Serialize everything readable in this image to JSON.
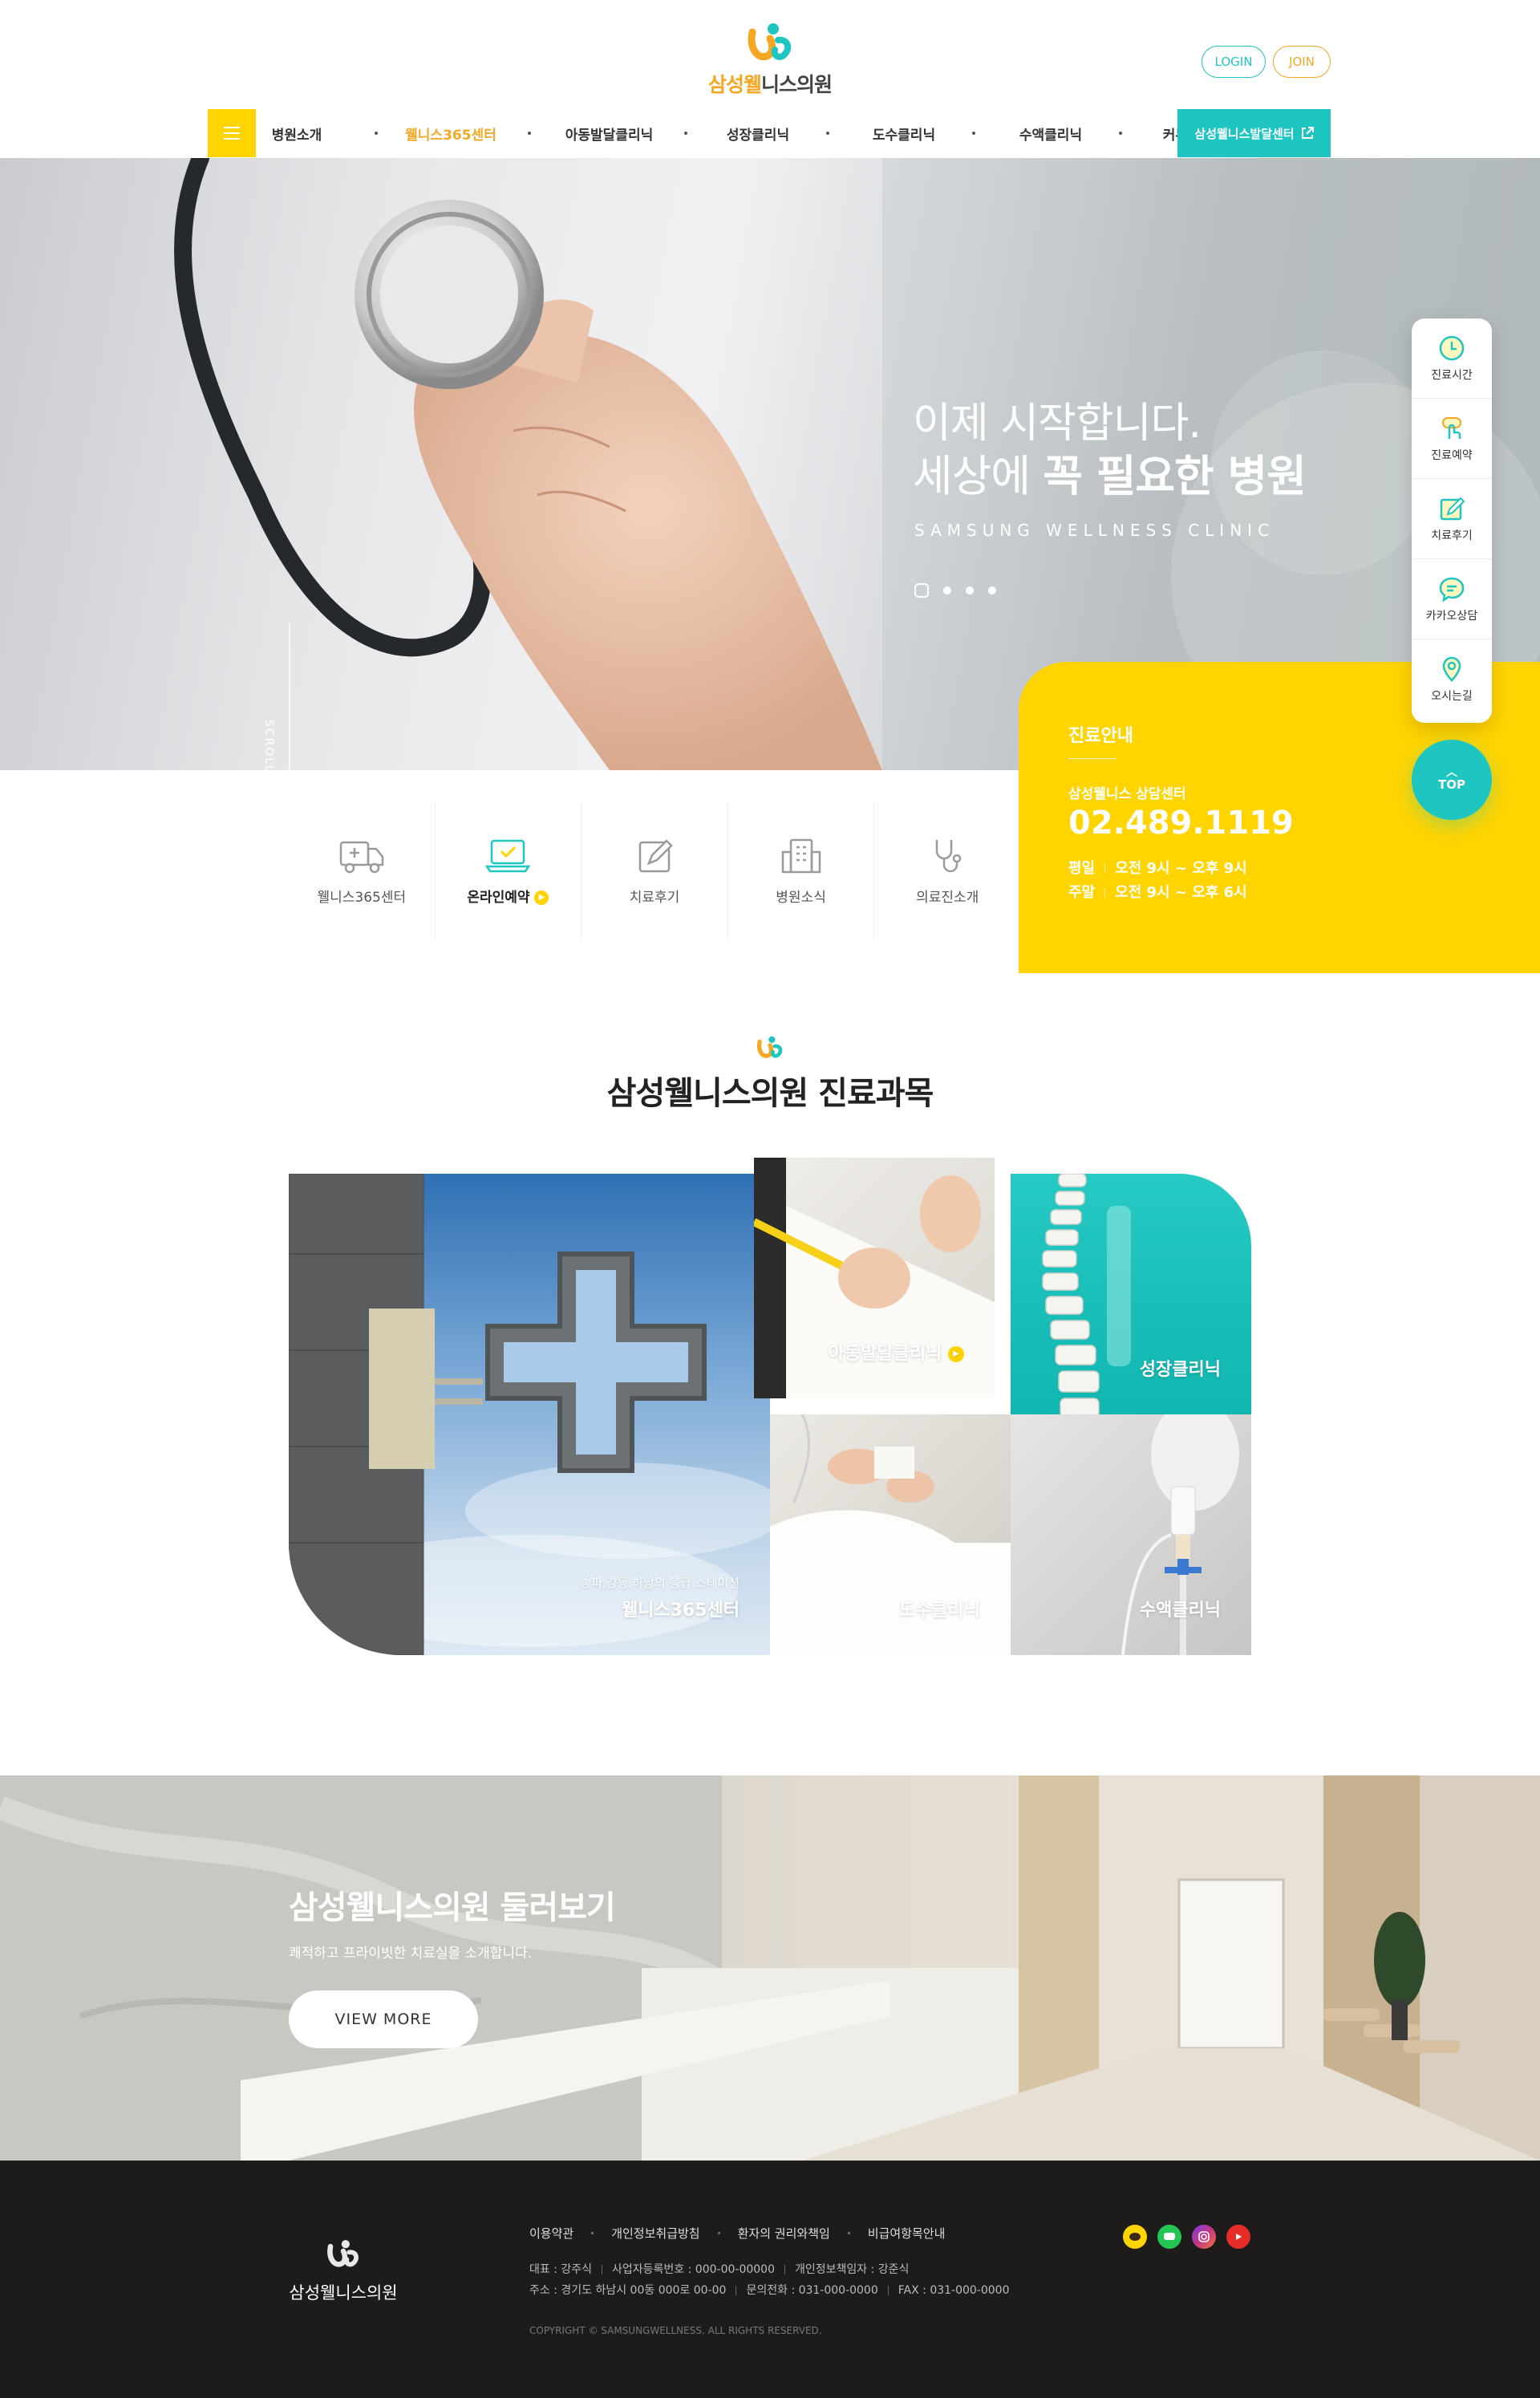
{
  "header": {
    "logo_part1": "삼성웰",
    "logo_part2": "니스의원",
    "login": "LOGIN",
    "join": "JOIN",
    "nav": [
      "병원소개",
      "웰니스365센터",
      "아동발달클리닉",
      "성장클리닉",
      "도수클리닉",
      "수액클리닉",
      "커뮤니티"
    ],
    "nav_active_index": 1,
    "dev_center": "삼성웰니스발달센터"
  },
  "hero": {
    "title1": "이제 시작합니다.",
    "title2_pre": "세상에 ",
    "title2_bold": "꼭 필요한 병원",
    "subtitle": "SAMSUNG WELLNESS CLINIC",
    "scroll": "SCROLL DOWN",
    "slides_total": 4,
    "slide_active": 1
  },
  "info": {
    "title": "진료안내",
    "sub": "삼성웰니스 상담센터",
    "tel": "02.489.1119",
    "weekday_label": "평일",
    "weekday": "오전 9시 ~ 오후 9시",
    "weekend_label": "주말",
    "weekend": "오전 9시 ~ 오후 6시"
  },
  "quick": [
    {
      "label": "웰니스365센터",
      "icon": "ambulance-icon"
    },
    {
      "label": "온라인예약",
      "icon": "laptop-check-icon",
      "active": true
    },
    {
      "label": "치료후기",
      "icon": "pencil-note-icon"
    },
    {
      "label": "병원소식",
      "icon": "building-icon"
    },
    {
      "label": "의료진소개",
      "icon": "stethoscope-icon"
    }
  ],
  "side": [
    {
      "label": "진료시간",
      "icon": "clock-icon"
    },
    {
      "label": "진료예약",
      "icon": "hand-tap-icon"
    },
    {
      "label": "치료후기",
      "icon": "write-icon"
    },
    {
      "label": "카카오상담",
      "icon": "chat-icon"
    },
    {
      "label": "오시는길",
      "icon": "map-pin-icon"
    }
  ],
  "top": "TOP",
  "section": {
    "title": "삼성웰니스의원 진료과목"
  },
  "gallery": {
    "g1_sub": "송파,강동,하남의 응급 스테이션",
    "g1": "웰니스365센터",
    "g2": "아동발달클리닉",
    "g3": "성장클리닉",
    "g4": "도수클리닉",
    "g5": "수액클리닉"
  },
  "tour": {
    "title": "삼성웰니스의원 둘러보기",
    "desc": "쾌적하고 프라이빗한 치료실을 소개합니다.",
    "button": "VIEW MORE"
  },
  "footer": {
    "logo": "삼성웰니스의원",
    "links": [
      "이용약관",
      "개인정보취급방침",
      "환자의 권리와책임",
      "비급여항목안내"
    ],
    "ceo": "대표 : 강주식",
    "biz": "사업자등록번호 : 000-00-00000",
    "privacy": "개인정보책임자 : 강준식",
    "addr": "주소 : 경기도 하남시 00동 000로 00-00",
    "tel": "문의전화 : 031-000-0000",
    "fax": "FAX : 031-000-0000",
    "copy": "COPYRIGHT © SAMSUNGWELLNESS. ALL RIGHTS RESERVED.",
    "sns": [
      {
        "name": "kakao-story-icon",
        "color": "#ffd400"
      },
      {
        "name": "talk-icon",
        "color": "#23c553"
      },
      {
        "name": "instagram-icon",
        "color": "#c13584"
      },
      {
        "name": "youtube-icon",
        "color": "#e52d27"
      }
    ]
  },
  "colors": {
    "yellow": "#ffd400",
    "teal": "#1fc6c1",
    "orange": "#f5a623",
    "dark": "#1e1c1b"
  }
}
